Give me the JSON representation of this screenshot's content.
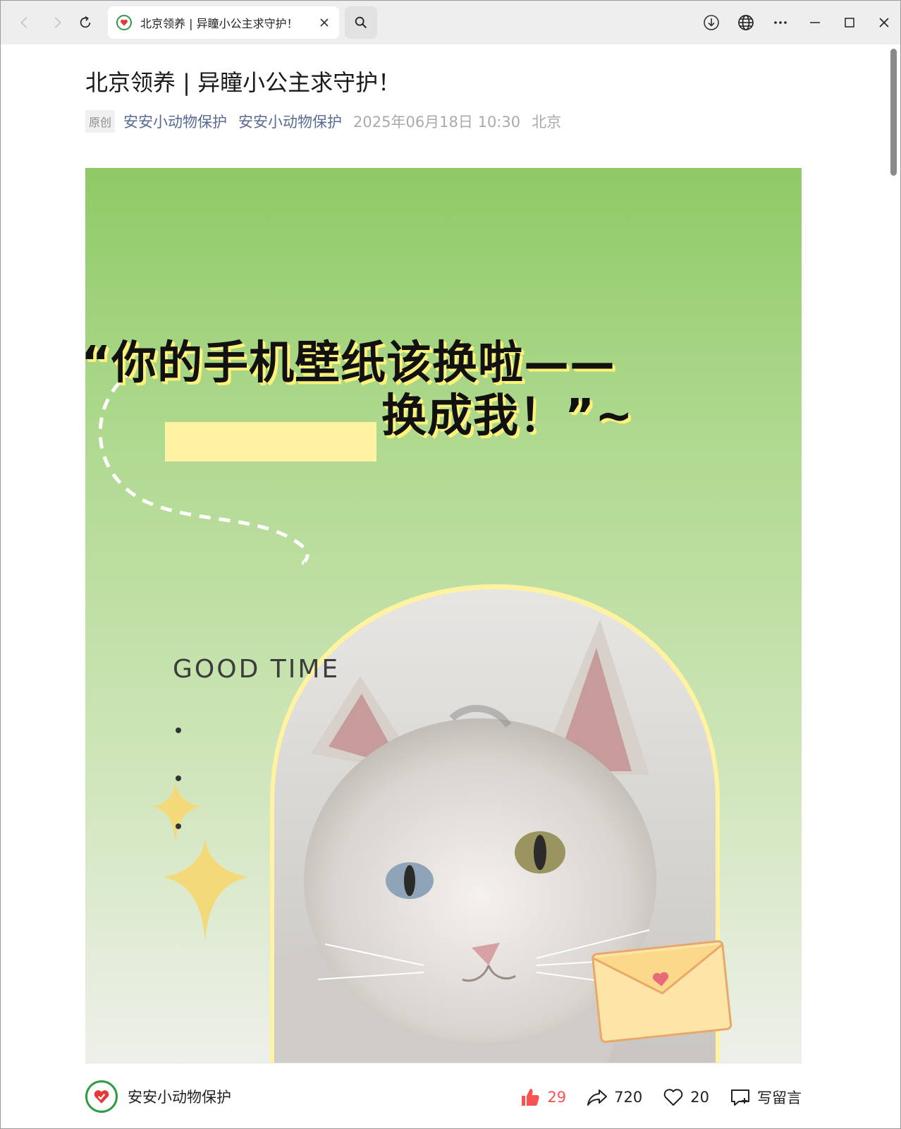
{
  "browser": {
    "tab_title": "北京领养 | 异瞳小公主求守护！"
  },
  "article": {
    "title": "北京领养 | 异瞳小公主求守护！",
    "badge": "原创",
    "author": "安安小动物保护",
    "account": "安安小动物保护",
    "datetime": "2025年06月18日 10:30",
    "location": "北京"
  },
  "poster": {
    "headline_line1": "“你的手机壁纸该换啦——",
    "headline_line2": "换成我！”~",
    "tagline": "GOOD TIME"
  },
  "footer": {
    "account_name": "安安小动物保护",
    "like_count": "29",
    "share_count": "720",
    "favorite_count": "20",
    "comment_label": "写留言"
  },
  "colors": {
    "like_red": "#fa5151",
    "link_blue": "#576b95",
    "poster_green": "#8fca66",
    "highlight_yellow": "#fff27a"
  }
}
